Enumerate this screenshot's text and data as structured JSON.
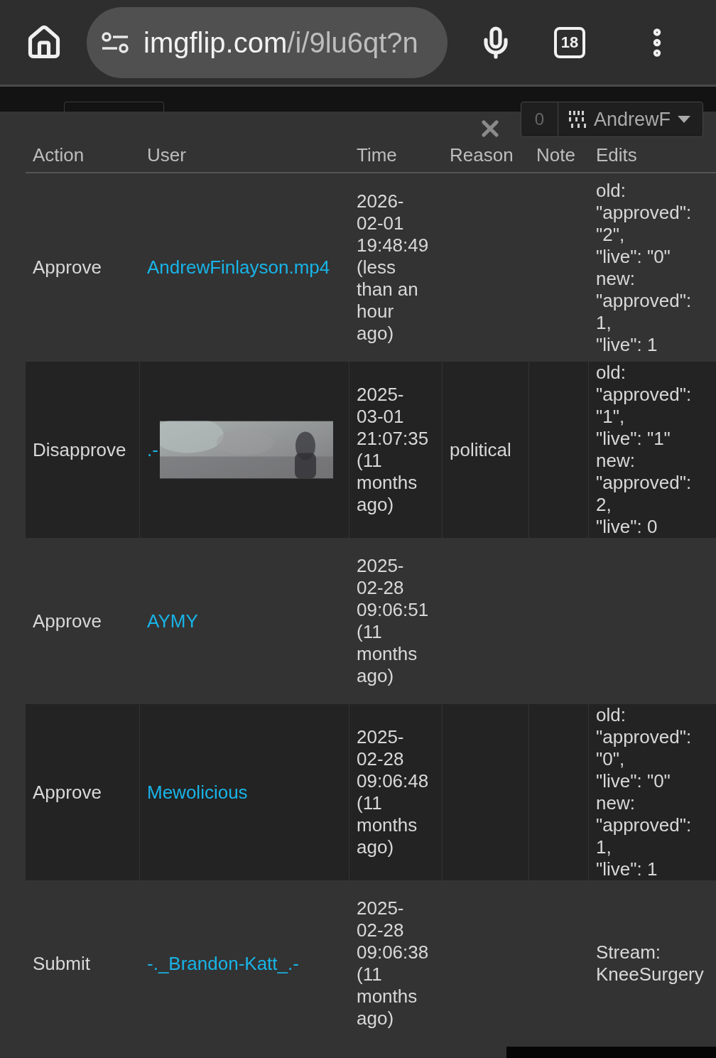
{
  "browser": {
    "url_host": "imgflip.com",
    "url_path": "/i/9lu6qt?n",
    "tab_count": "18"
  },
  "account": {
    "points": "0",
    "username": "AndrewF"
  },
  "table": {
    "columns": [
      "Action",
      "User",
      "Time",
      "Reason",
      "Note",
      "Edits"
    ],
    "rows": [
      {
        "action": "Approve",
        "user": "AndrewFinlayson.mp4",
        "time": [
          "2026-",
          "02-01",
          "19:48:49",
          "(less",
          "than an",
          "hour",
          "ago)"
        ],
        "reason": "",
        "note": "",
        "edits": [
          "old:",
          "\"approved\":",
          "\"2\",",
          "\"live\": \"0\"",
          "new:",
          "\"approved\":",
          "1,",
          "\"live\": 1"
        ]
      },
      {
        "action": "Disapprove",
        "user": ".-",
        "thumbnail": {
          "kind": "picture"
        },
        "time": [
          "2025-",
          "03-01",
          "21:07:35",
          "(11",
          "months",
          "ago)"
        ],
        "reason": "political",
        "note": "",
        "edits": [
          "old:",
          "\"approved\":",
          "\"1\",",
          "\"live\": \"1\"",
          "new:",
          "\"approved\":",
          "2,",
          "\"live\": 0"
        ]
      },
      {
        "action": "Approve",
        "user": "AYMY",
        "time": [
          "2025-",
          "02-28",
          "09:06:51",
          "(11",
          "months",
          "ago)"
        ],
        "reason": "",
        "note": "",
        "edits": []
      },
      {
        "action": "Approve",
        "user": "Mewolicious",
        "time": [
          "2025-",
          "02-28",
          "09:06:48",
          "(11",
          "months",
          "ago)"
        ],
        "reason": "",
        "note": "",
        "edits": [
          "old:",
          "\"approved\":",
          "\"0\",",
          "\"live\": \"0\"",
          "new:",
          "\"approved\":",
          "1,",
          "\"live\": 1"
        ]
      },
      {
        "action": "Submit",
        "user": "-._Brandon-Katt_.-",
        "time": [
          "2025-",
          "02-28",
          "09:06:38",
          "(11",
          "months",
          "ago)"
        ],
        "reason": "",
        "note": "",
        "edits": [
          "Stream:",
          "KneeSurgery"
        ]
      }
    ]
  }
}
